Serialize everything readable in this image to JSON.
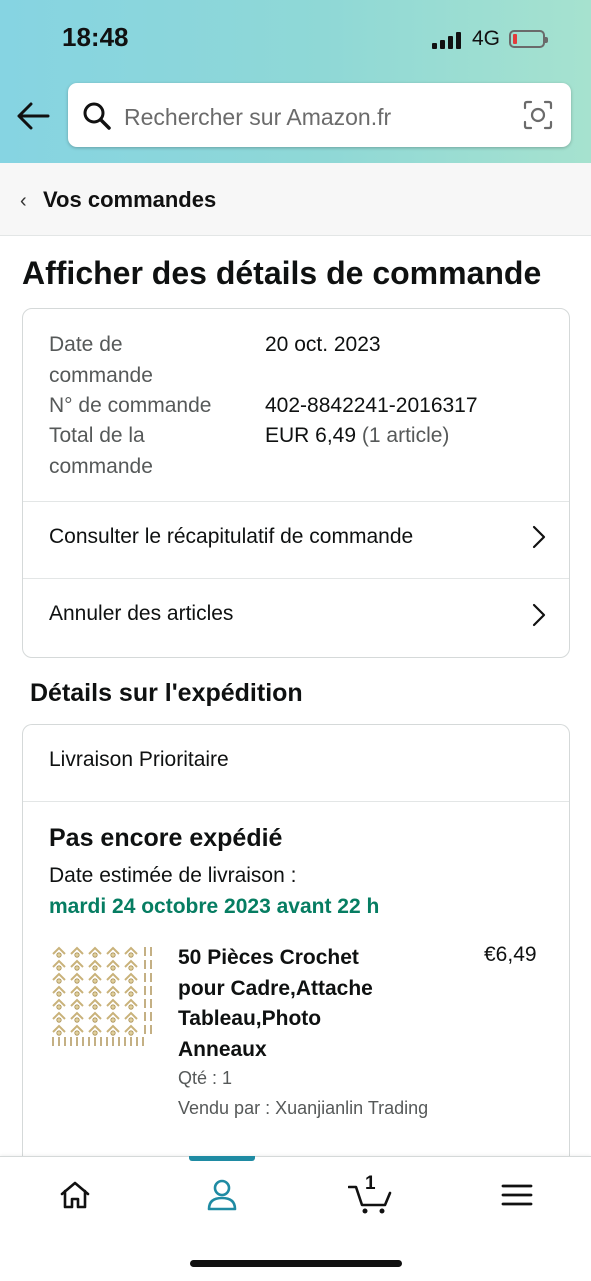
{
  "status_bar": {
    "time": "18:48",
    "network": "4G"
  },
  "search": {
    "placeholder": "Rechercher sur Amazon.fr"
  },
  "breadcrumb": {
    "label": "Vos commandes"
  },
  "page": {
    "title": "Afficher des détails de commande"
  },
  "order_info": {
    "date_label": "Date de commande",
    "date_value": "20 oct. 2023",
    "number_label": "N° de commande",
    "number_value": "402-8842241-2016317",
    "total_label": "Total de la commande",
    "total_value": "EUR 6,49",
    "total_items": "(1 article)"
  },
  "actions": {
    "summary": "Consulter le récapitulatif de commande",
    "cancel": "Annuler des articles"
  },
  "shipping": {
    "section_title": "Détails sur l'expédition",
    "method": "Livraison Prioritaire",
    "status": "Pas encore expédié",
    "estimate_label": "Date estimée de livraison :",
    "estimate_date": "mardi 24 octobre 2023 avant 22 h"
  },
  "item": {
    "title": "50 Pièces Crochet pour Cadre,Attache Tableau,Photo Anneaux",
    "price": "€6,49",
    "quantity": "Qté : 1",
    "seller": "Vendu par : Xuanjianlin Trading"
  },
  "bottom_nav": {
    "cart_count": "1",
    "active": "account"
  },
  "colors": {
    "delivery_green": "#067d62",
    "nav_active": "#1f8ba3"
  },
  "icons": [
    "back-arrow-icon",
    "search-icon",
    "camera-icon",
    "chevron-left-icon",
    "chevron-right-icon",
    "home-icon",
    "account-icon",
    "cart-icon",
    "menu-icon"
  ]
}
